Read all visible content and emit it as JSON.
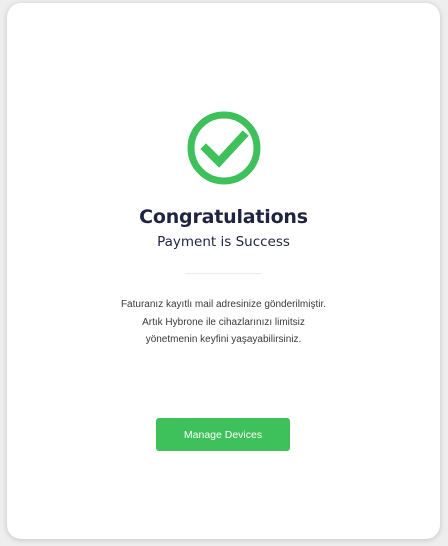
{
  "colors": {
    "accent": "#3ec05a",
    "title": "#1f2440",
    "card": "#ffffff",
    "background": "#eeeeee"
  },
  "status_icon": "check-circle-icon",
  "title": "Congratulations",
  "subtitle": "Payment is Success",
  "message_lines": [
    "Faturanız kayıtlı mail adresinize gönderilmiştir.",
    "Artık Hybrone ile cihazlarınızı limitsiz",
    "yönetmenin keyfini yaşayabilirsiniz."
  ],
  "primary_button_label": "Manage Devices"
}
